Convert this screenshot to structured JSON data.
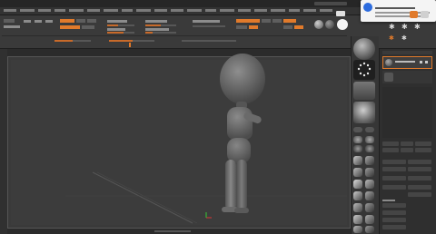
{
  "window": {
    "title": ""
  },
  "menubar": {
    "items": [
      "",
      "",
      "",
      "",
      "",
      "",
      "",
      "",
      "",
      "",
      "",
      "",
      "",
      "",
      "",
      "",
      "",
      "",
      "",
      ""
    ]
  },
  "toolbar": {
    "accent_color": "#e07a2b"
  },
  "notification": {
    "title": "",
    "body": ""
  },
  "canvas": {
    "bottom_label": ""
  },
  "subtool": {
    "item_label": ""
  },
  "icons": {
    "palette": [
      "home-icon",
      "gear-icon",
      "brush-icon",
      "material-icon",
      "transform-icon",
      "subtool-icon"
    ]
  },
  "colors": {
    "background": "#2b2b2b",
    "canvas": "#3c3c3c",
    "accent": "#e07a2b",
    "notification_icon": "#2d6cdf"
  }
}
